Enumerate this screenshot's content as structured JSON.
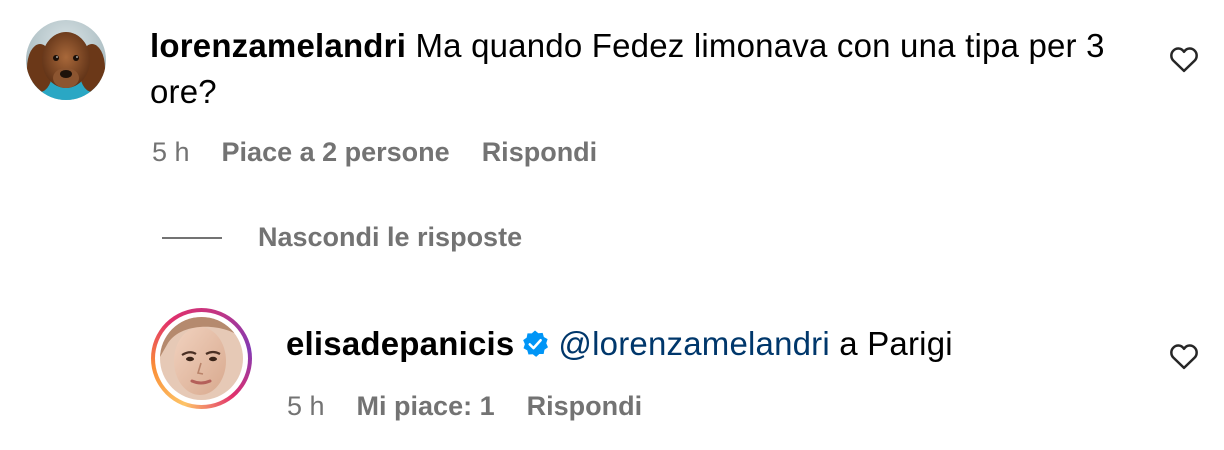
{
  "comment": {
    "username": "lorenzamelandri",
    "text": "Ma quando Fedez limonava con una tipa per 3 ore?",
    "time": "5 h",
    "likes": "Piace a 2 persone",
    "reply_label": "Rispondi",
    "avatar_icon": "dog-avatar",
    "like_icon": "heart-outline-icon"
  },
  "replies_toggle": {
    "label": "Nascondi le risposte"
  },
  "reply": {
    "username": "elisadepanicis",
    "verified": true,
    "mention": "@lorenzamelandri",
    "text": "a Parigi",
    "time": "5 h",
    "likes": "Mi piace: 1",
    "reply_label": "Rispondi",
    "avatar_icon": "woman-portrait-avatar",
    "like_icon": "heart-outline-icon"
  },
  "colors": {
    "username": "#000000",
    "meta_text": "#737373",
    "mention": "#00376b",
    "verified_badge": "#0095f6"
  }
}
